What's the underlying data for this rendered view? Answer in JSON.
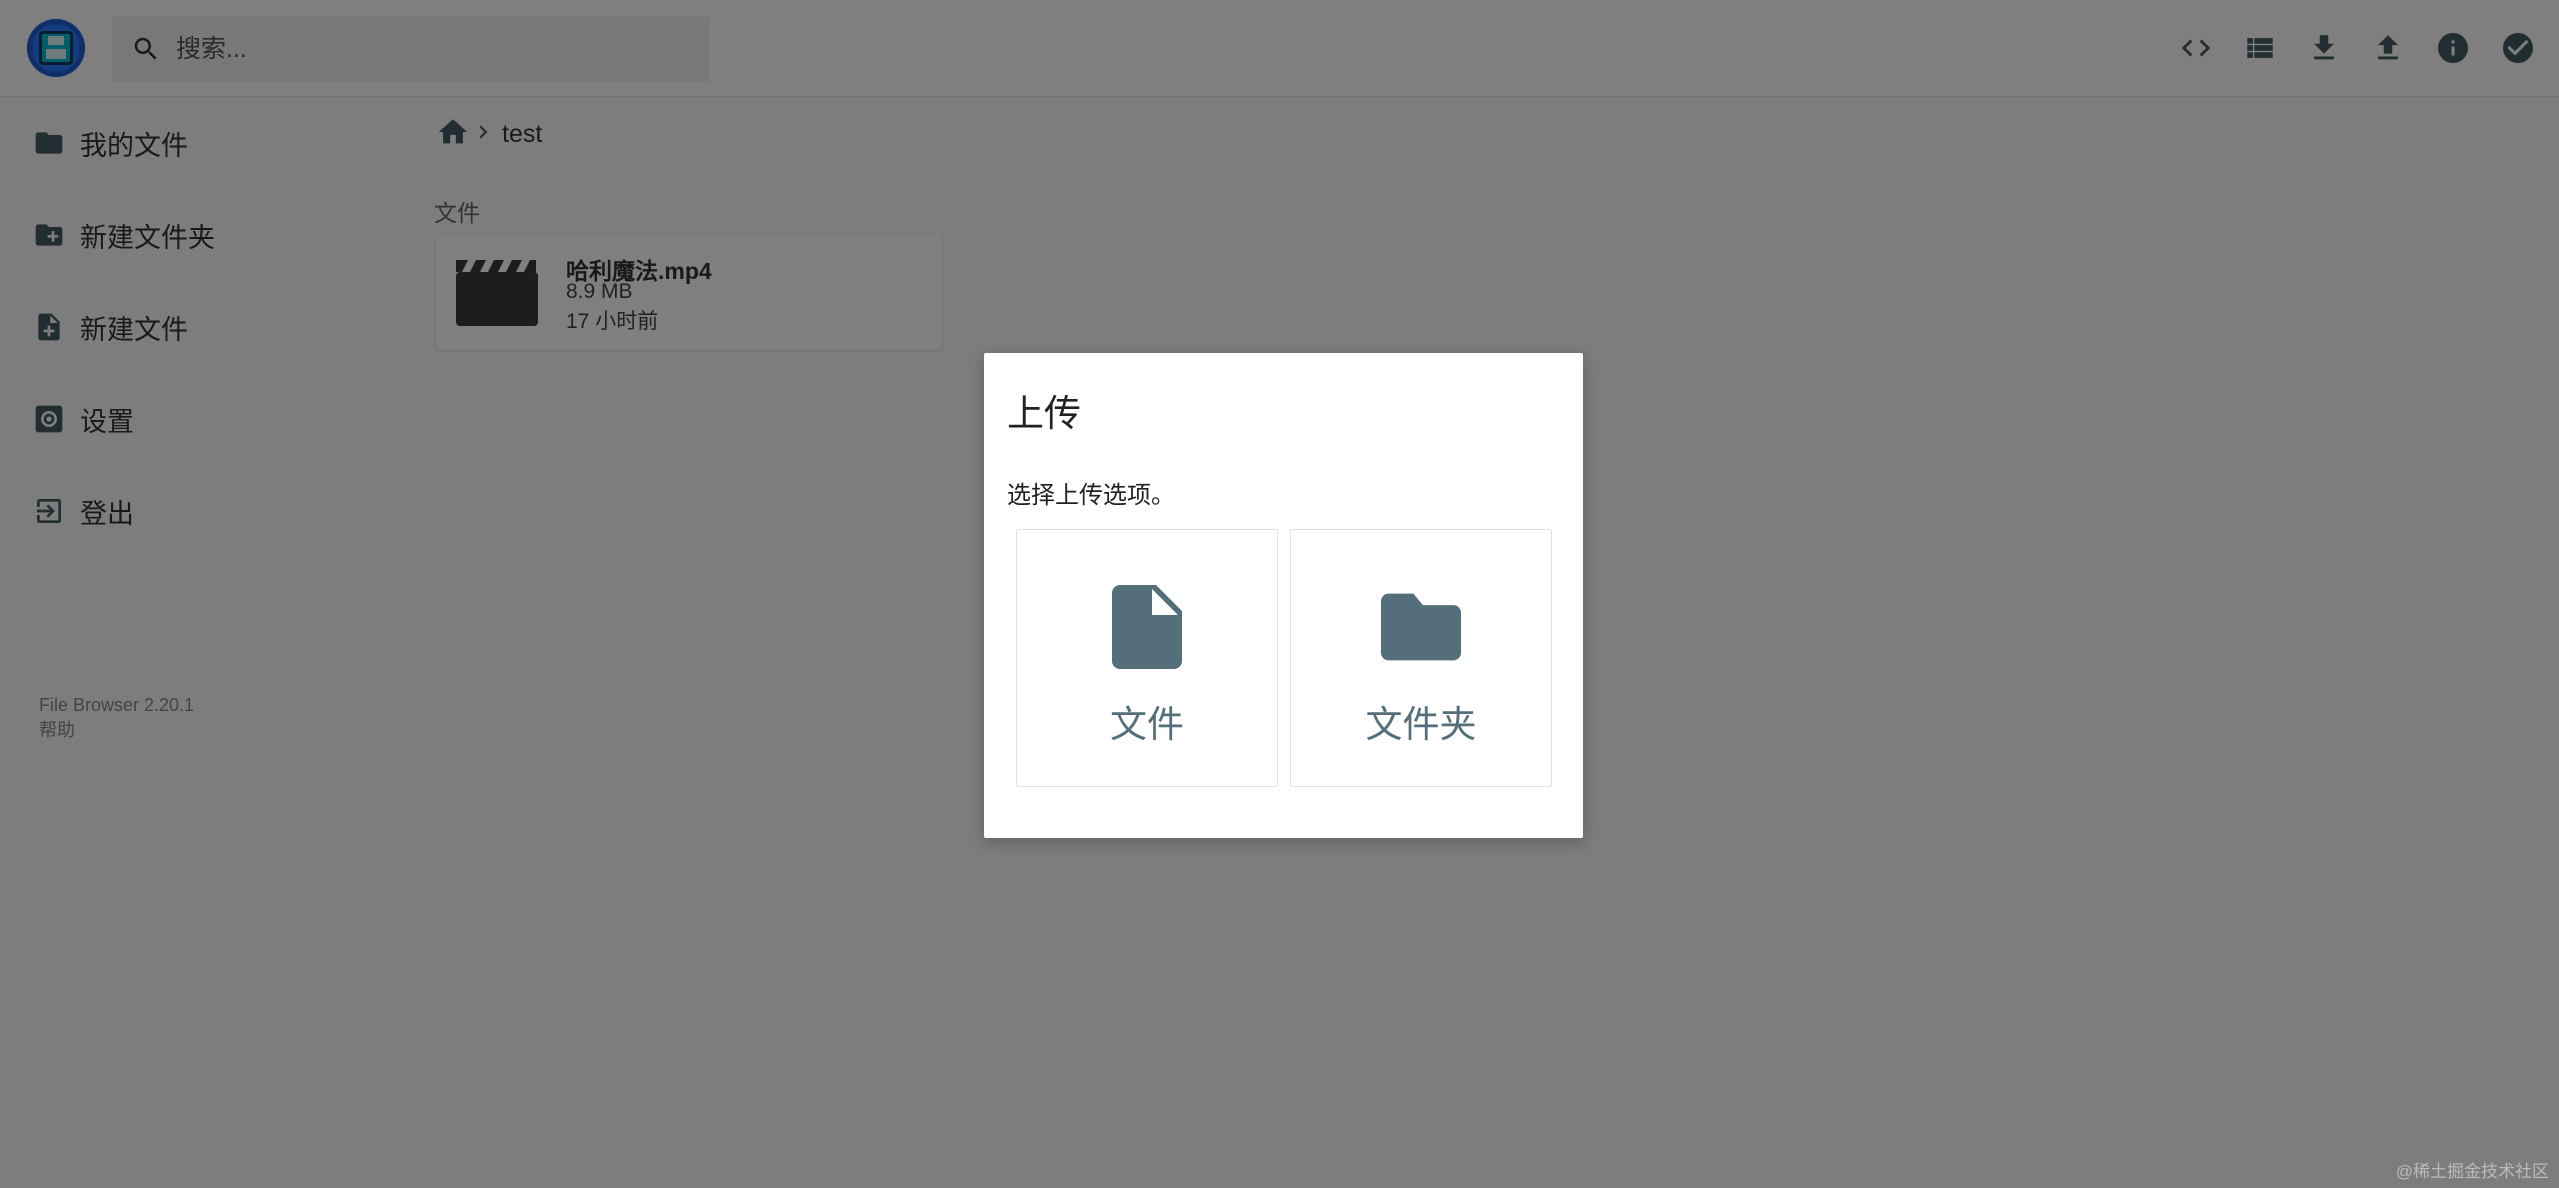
{
  "search": {
    "placeholder": "搜索..."
  },
  "sidebar": {
    "items": [
      {
        "label": "我的文件",
        "icon": "folder-icon"
      },
      {
        "label": "新建文件夹",
        "icon": "create-folder-icon"
      },
      {
        "label": "新建文件",
        "icon": "note-add-icon"
      },
      {
        "label": "设置",
        "icon": "settings-icon"
      },
      {
        "label": "登出",
        "icon": "logout-icon"
      }
    ],
    "credits": {
      "version": "File Browser 2.20.1",
      "help": "帮助"
    }
  },
  "breadcrumb": {
    "path": "test"
  },
  "main": {
    "section_title": "文件",
    "files": [
      {
        "name": "哈利魔法.mp4",
        "size": "8.9 MB",
        "modified": "17 小时前",
        "icon": "movie-icon"
      }
    ]
  },
  "toolbar": {
    "buttons": [
      "code-icon",
      "list-view-icon",
      "download-icon",
      "upload-icon",
      "info-icon",
      "check-circle-icon"
    ]
  },
  "dialog": {
    "title": "上传",
    "description": "选择上传选项。",
    "options": [
      {
        "label": "文件",
        "icon": "file-icon"
      },
      {
        "label": "文件夹",
        "icon": "folder-icon"
      }
    ]
  },
  "watermark": "@稀土掘金技术社区",
  "colors": {
    "accent": "#2979ff",
    "icon_gray": "#455a64",
    "option_icon": "#546e7a",
    "overlay": "rgba(0,0,0,0.5)"
  }
}
